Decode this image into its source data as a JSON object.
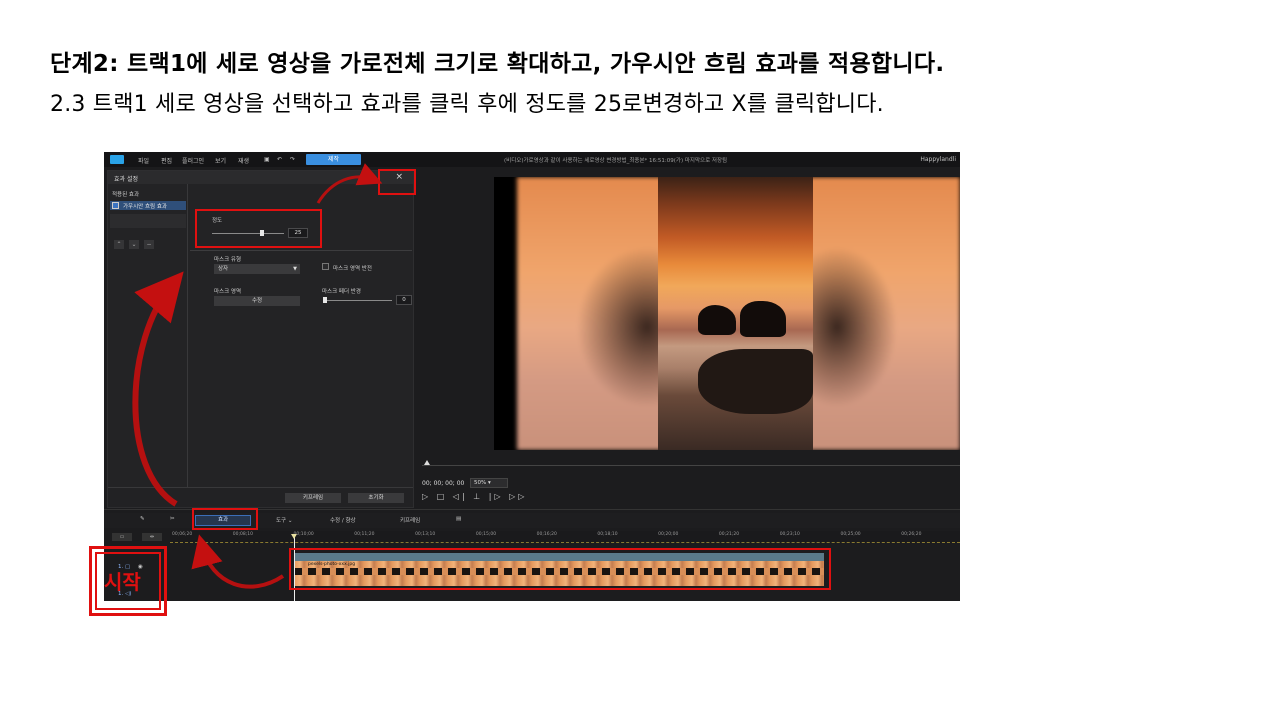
{
  "slide": {
    "title": "단계2: 트랙1에 세로 영상을 가로전체 크기로 확대하고, 가우시안 흐림 효과를 적용합니다.",
    "subtitle": "2.3 트랙1 세로 영상을 선택하고 효과를 클릭 후에 정도를 25로변경하고 X를 클릭합니다.",
    "start_label": "시작",
    "annotation_color": "#e01010"
  },
  "menubar": {
    "items": [
      "파일",
      "편집",
      "플러그인",
      "보기",
      "재생"
    ],
    "produce_button": "제작",
    "project_title": "(비디오)가로영상과 같이 사용하는 세로영상 변경방법_최종본* 16:51:09(가) 마지막으로 저장됨",
    "user": "Happylandli"
  },
  "effect_panel": {
    "header": "효과 설정",
    "close_glyph": "×",
    "applied_label": "적용된 효과",
    "applied_item": "가우시안 흐림 효과",
    "degree_label": "정도",
    "degree_value": "25",
    "degree_fraction": 0.7,
    "mask_type_label": "마스크 유형",
    "mask_type_value": "상자",
    "mask_invert_label": "마스크 영역 반전",
    "mask_area_label": "마스크 영역",
    "mask_area_button": "수정",
    "mask_feather_label": "마스크 페더 반경",
    "mask_feather_value": "0",
    "keyframe_button": "키프레임",
    "reset_button": "초기화"
  },
  "preview": {
    "timecode": "00; 00; 00; 00",
    "zoom": "50%",
    "controls": "▷ □ ◁| ⊥ |▷ ▷▷"
  },
  "toolbar": {
    "effects_tab": "효과",
    "tools_tab": "도구",
    "fix_tab": "수정 / 향상",
    "keyframe_tab": "키프레임"
  },
  "timeline": {
    "ticks": [
      "00;06;20",
      "00;08;10",
      "00;10;00",
      "00;11;20",
      "00;13;10",
      "00;15;00",
      "00;16;20",
      "00;18;10",
      "00;20;00",
      "00;21;20",
      "00;23;10",
      "00;25;00",
      "00;26;20"
    ],
    "track_video_label": "1. ▢",
    "track_audio_label": "1. ◁)",
    "clip_name": "pexels-photo-xxx.jpg"
  }
}
